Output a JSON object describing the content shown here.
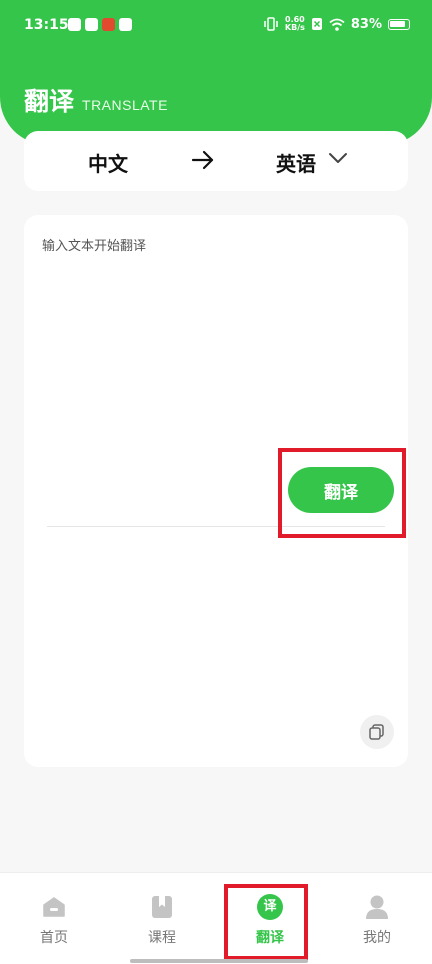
{
  "status_bar": {
    "time": "13:15",
    "net_speed_value": "0.60",
    "net_speed_unit": "KB/s",
    "battery": "83%"
  },
  "header": {
    "title": "翻译",
    "subtitle": "TRANSLATE"
  },
  "language": {
    "source": "中文",
    "target": "英语"
  },
  "input": {
    "placeholder": "输入文本开始翻译",
    "value": ""
  },
  "actions": {
    "translate_label": "翻译"
  },
  "tabs": [
    {
      "label": "首页",
      "icon": "home-icon",
      "active": false
    },
    {
      "label": "课程",
      "icon": "book-icon",
      "active": false
    },
    {
      "label": "翻译",
      "icon": "translate-icon",
      "active": true,
      "icon_text": "译"
    },
    {
      "label": "我的",
      "icon": "profile-icon",
      "active": false
    }
  ],
  "colors": {
    "accent": "#35c54a",
    "highlight": "#e21b2a"
  }
}
